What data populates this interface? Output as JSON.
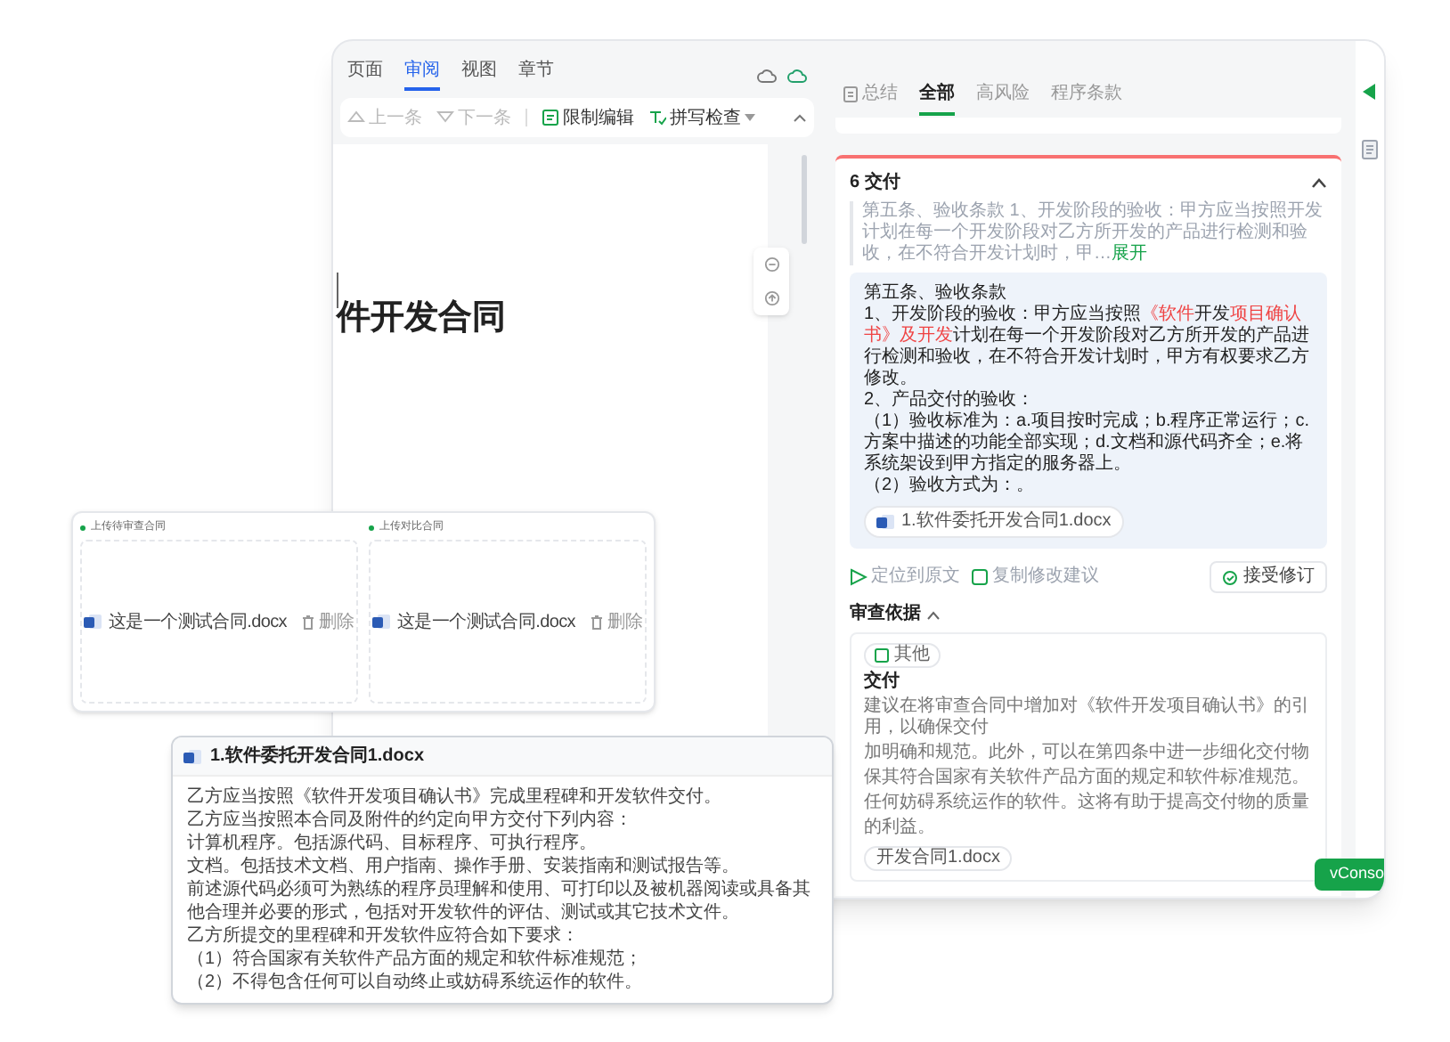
{
  "doc_editor": {
    "tabs": [
      {
        "label": "页面",
        "selected": false
      },
      {
        "label": "审阅",
        "selected": true
      },
      {
        "label": "视图",
        "selected": false
      },
      {
        "label": "章节",
        "selected": false
      }
    ],
    "toolbar": [
      {
        "kind": "prev",
        "label": "上一条",
        "disabled": true
      },
      {
        "kind": "next",
        "label": "下一条",
        "disabled": true
      },
      {
        "kind": "restrict",
        "label": "限制编辑",
        "disabled": false
      },
      {
        "kind": "spell",
        "label": "拼写检查",
        "disabled": false
      }
    ],
    "title": "件开发合同"
  },
  "review_panel": {
    "tabs": [
      {
        "label": "总结",
        "selected": false,
        "kind": "summary"
      },
      {
        "label": "全部",
        "selected": true
      },
      {
        "label": "高风险",
        "selected": false
      },
      {
        "label": "程序条款",
        "selected": false
      }
    ],
    "clause": {
      "title": "6 交付",
      "expanded": true,
      "excerpt": "第五条、验收条款 1、开发阶段的验收：甲方应当按照开发计划在每一个开发阶段对乙方所开发的产品进行检测和验收，在不符合开发计划时，甲…",
      "expand_link": "展开",
      "suggestion": [
        [
          {
            "text": "第五条、验收条款",
            "kind": "plain"
          }
        ],
        [
          {
            "text": "1、开发阶段的验收：甲方应当按照",
            "kind": "plain"
          },
          {
            "text": "《软件",
            "kind": "insert"
          },
          {
            "text": "开发",
            "kind": "plain"
          },
          {
            "text": "项目确认书》及开发",
            "kind": "insert"
          },
          {
            "text": "计划在每一个开发阶段对乙方所开发的产品进行检测和验收，在不符合开发计划时，甲方有权要求乙方修改。",
            "kind": "plain"
          }
        ],
        [
          {
            "text": "2、产品交付的验收：",
            "kind": "plain"
          }
        ],
        [
          {
            "text": "（1）验收标准为：a.项目按时完成；b.程序正常运行；c.方案中描述的功能全部实现；d.文档和源代码齐全；e.将系统架设到甲方指定的服务器上。",
            "kind": "plain"
          }
        ],
        [
          {
            "text": "（2）验收方式为：。",
            "kind": "plain"
          }
        ]
      ],
      "suggestion_file": "1.软件委托开发合同1.docx",
      "actions": [
        {
          "kind": "locate",
          "label": "定位到原文"
        },
        {
          "kind": "copy",
          "label": "复制修改建议"
        }
      ],
      "accept_button": "接受修订",
      "basis_title": "审查依据",
      "basis_expanded": true,
      "basis": {
        "tag": "其他",
        "heading": "交付",
        "lines": [
          "建议在将审查合同中增加对《软件开发项目确认书》的引用，以确保交付",
          "加明确和规范。此外，可以在第四条中进一步细化交付物",
          "保其符合国家有关软件产品方面的规定和软件标准规范。",
          "任何妨碍系统运作的软件。这将有助于提高交付物的质量",
          "的利益。"
        ],
        "file": "开发合同1.docx"
      }
    }
  },
  "vconsole_button": "vConso",
  "upload_panel": {
    "slots": [
      {
        "label": "上传待审查合同",
        "file": "这是一个测试合同.docx",
        "delete": "删除"
      },
      {
        "label": "上传对比合同",
        "file": "这是一个测试合同.docx",
        "delete": "删除"
      }
    ]
  },
  "file_preview": {
    "title": "1.软件委托开发合同1.docx",
    "lines": [
      "乙方应当按照《软件开发项目确认书》完成里程碑和开发软件交付。",
      "乙方应当按照本合同及附件的约定向甲方交付下列内容：",
      "计算机程序。包括源代码、目标程序、可执行程序。",
      "文档。包括技术文档、用户指南、操作手册、安装指南和测试报告等。",
      "前述源代码必须可为熟练的程序员理解和使用、可打印以及被机器阅读或具备其他合理并必要的形式，包括对开发软件的评估、测试或其它技术文件。",
      "乙方所提交的里程碑和开发软件应符合如下要求：",
      "（1）符合国家有关软件产品方面的规定和软件标准规范；",
      "（2）不得包含任何可以自动终止或妨碍系统运作的软件。"
    ]
  }
}
